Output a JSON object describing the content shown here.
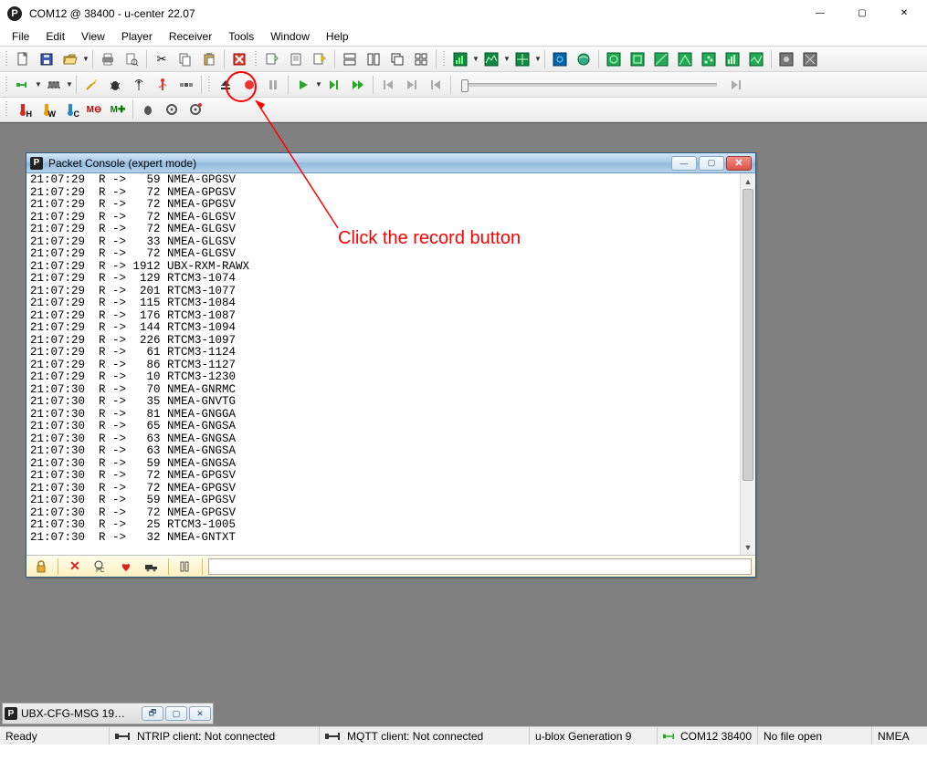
{
  "window": {
    "title": "COM12 @ 38400 - u-center 22.07",
    "controls": {
      "min": "—",
      "max": "▢",
      "close": "✕"
    }
  },
  "menu": {
    "items": [
      "File",
      "Edit",
      "View",
      "Player",
      "Receiver",
      "Tools",
      "Window",
      "Help"
    ]
  },
  "toolbar1": {
    "new": "new",
    "save": "save",
    "open": "open",
    "print": "print",
    "printpreview": "print-preview",
    "cut": "cut",
    "copy": "copy",
    "paste": "paste",
    "abort": "abort",
    "gen": "gen",
    "doc": "doc",
    "find": "find",
    "win_a": "tile-h",
    "win_b": "tile-v",
    "win_c": "cascade",
    "win_d": "arrange",
    "chart_a": "chart-sat",
    "chart_b": "chart-sky",
    "chart_c": "chart-sig",
    "ext_a": "ext1",
    "ext_b": "ext2",
    "grid_a": "g1",
    "grid_b": "g2",
    "grid_c": "g3",
    "grid_d": "g4",
    "grid_e": "g5",
    "grid_f": "g6",
    "grid_g": "g7",
    "last_a": "l1",
    "last_b": "l2"
  },
  "toolbar2": {
    "conn": "connect",
    "disc": "disconnect",
    "pulse": "pulse",
    "wand": "wand",
    "bug": "bug",
    "ant": "antenna",
    "usb": "usb",
    "sat": "sat",
    "eject": "eject",
    "record": "record",
    "pause": "pause",
    "play": "play",
    "step": "step",
    "ffwd": "ffwd",
    "prev": "prev",
    "next": "next",
    "end": "end"
  },
  "toolbar3": {
    "h": "H",
    "w": "W",
    "therm": "therm",
    "mo": "MO",
    "mp": "M+",
    "bug": "bug",
    "gear": "gear",
    "geardot": "gear-dot"
  },
  "packet_console": {
    "title": "Packet Console (expert mode)",
    "footer_input": "",
    "rows": [
      {
        "t": "21:07:29",
        "d": "R",
        "a": "->",
        "s": "59",
        "m": "NMEA-GPGSV"
      },
      {
        "t": "21:07:29",
        "d": "R",
        "a": "->",
        "s": "72",
        "m": "NMEA-GPGSV"
      },
      {
        "t": "21:07:29",
        "d": "R",
        "a": "->",
        "s": "72",
        "m": "NMEA-GPGSV"
      },
      {
        "t": "21:07:29",
        "d": "R",
        "a": "->",
        "s": "72",
        "m": "NMEA-GLGSV"
      },
      {
        "t": "21:07:29",
        "d": "R",
        "a": "->",
        "s": "72",
        "m": "NMEA-GLGSV"
      },
      {
        "t": "21:07:29",
        "d": "R",
        "a": "->",
        "s": "33",
        "m": "NMEA-GLGSV"
      },
      {
        "t": "21:07:29",
        "d": "R",
        "a": "->",
        "s": "72",
        "m": "NMEA-GLGSV"
      },
      {
        "t": "21:07:29",
        "d": "R",
        "a": "->",
        "s": "1912",
        "m": "UBX-RXM-RAWX"
      },
      {
        "t": "21:07:29",
        "d": "R",
        "a": "->",
        "s": "129",
        "m": "RTCM3-1074"
      },
      {
        "t": "21:07:29",
        "d": "R",
        "a": "->",
        "s": "201",
        "m": "RTCM3-1077"
      },
      {
        "t": "21:07:29",
        "d": "R",
        "a": "->",
        "s": "115",
        "m": "RTCM3-1084"
      },
      {
        "t": "21:07:29",
        "d": "R",
        "a": "->",
        "s": "176",
        "m": "RTCM3-1087"
      },
      {
        "t": "21:07:29",
        "d": "R",
        "a": "->",
        "s": "144",
        "m": "RTCM3-1094"
      },
      {
        "t": "21:07:29",
        "d": "R",
        "a": "->",
        "s": "226",
        "m": "RTCM3-1097"
      },
      {
        "t": "21:07:29",
        "d": "R",
        "a": "->",
        "s": "61",
        "m": "RTCM3-1124"
      },
      {
        "t": "21:07:29",
        "d": "R",
        "a": "->",
        "s": "86",
        "m": "RTCM3-1127"
      },
      {
        "t": "21:07:29",
        "d": "R",
        "a": "->",
        "s": "10",
        "m": "RTCM3-1230"
      },
      {
        "t": "21:07:30",
        "d": "R",
        "a": "->",
        "s": "70",
        "m": "NMEA-GNRMC"
      },
      {
        "t": "21:07:30",
        "d": "R",
        "a": "->",
        "s": "35",
        "m": "NMEA-GNVTG"
      },
      {
        "t": "21:07:30",
        "d": "R",
        "a": "->",
        "s": "81",
        "m": "NMEA-GNGGA"
      },
      {
        "t": "21:07:30",
        "d": "R",
        "a": "->",
        "s": "65",
        "m": "NMEA-GNGSA"
      },
      {
        "t": "21:07:30",
        "d": "R",
        "a": "->",
        "s": "63",
        "m": "NMEA-GNGSA"
      },
      {
        "t": "21:07:30",
        "d": "R",
        "a": "->",
        "s": "63",
        "m": "NMEA-GNGSA"
      },
      {
        "t": "21:07:30",
        "d": "R",
        "a": "->",
        "s": "59",
        "m": "NMEA-GNGSA"
      },
      {
        "t": "21:07:30",
        "d": "R",
        "a": "->",
        "s": "72",
        "m": "NMEA-GPGSV"
      },
      {
        "t": "21:07:30",
        "d": "R",
        "a": "->",
        "s": "72",
        "m": "NMEA-GPGSV"
      },
      {
        "t": "21:07:30",
        "d": "R",
        "a": "->",
        "s": "59",
        "m": "NMEA-GPGSV"
      },
      {
        "t": "21:07:30",
        "d": "R",
        "a": "->",
        "s": "72",
        "m": "NMEA-GPGSV"
      },
      {
        "t": "21:07:30",
        "d": "R",
        "a": "->",
        "s": "25",
        "m": "RTCM3-1005"
      },
      {
        "t": "21:07:30",
        "d": "R",
        "a": "->",
        "s": "32",
        "m": "NMEA-GNTXT"
      }
    ]
  },
  "minwin": {
    "title": "UBX-CFG-MSG 19…"
  },
  "status": {
    "ready": "Ready",
    "ntrip": "NTRIP client: Not connected",
    "mqtt": "MQTT client: Not connected",
    "gen": "u-blox Generation 9",
    "port": "COM12 38400",
    "file": "No file open",
    "proto": "NMEA"
  },
  "annotation": {
    "text": "Click the record button"
  }
}
